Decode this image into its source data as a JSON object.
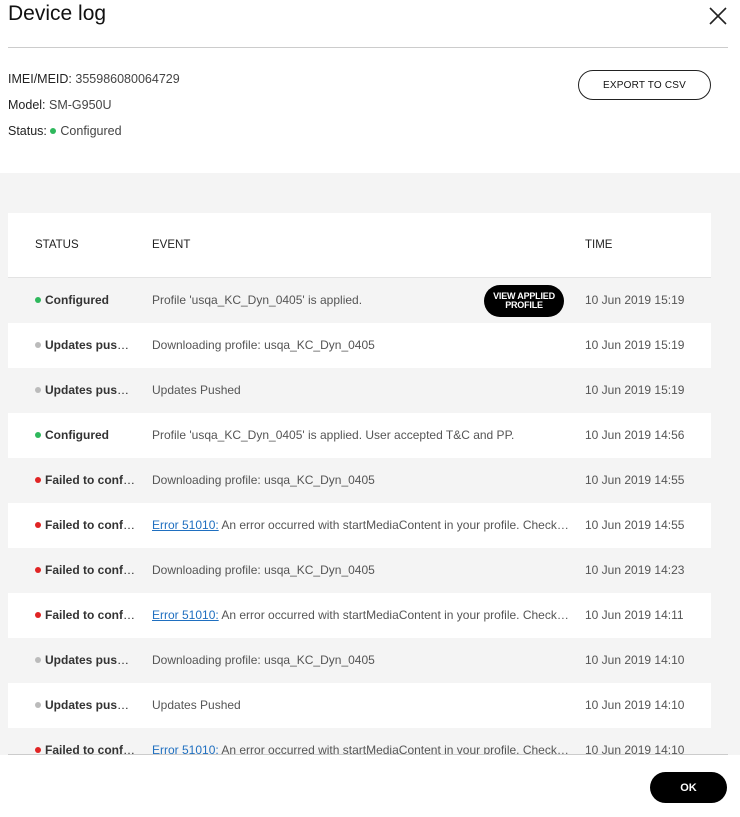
{
  "dialog": {
    "title": "Device log",
    "close_icon": "close-icon"
  },
  "device": {
    "imei_label": "IMEI/MEID:",
    "imei_value": "355986080064729",
    "model_label": "Model:",
    "model_value": "SM-G950U",
    "status_label": "Status:",
    "status_value": "Configured",
    "status_color": "#2eb85c"
  },
  "toolbar": {
    "export_label": "EXPORT TO CSV"
  },
  "colors": {
    "configured": "#2eb85c",
    "pushed": "#bbbbbb",
    "failed": "#e02424",
    "link": "#1f6fc0"
  },
  "table": {
    "headers": {
      "status": "STATUS",
      "event": "EVENT",
      "time": "TIME"
    },
    "view_button_label": "VIEW APPLIED PROFILE",
    "rows": [
      {
        "status": "Configured",
        "kind": "configured",
        "error_code": "",
        "event": "Profile 'usqa_KC_Dyn_0405' is applied.",
        "time": "10 Jun 2019 15:19",
        "has_view": true
      },
      {
        "status": "Updates pushed",
        "kind": "pushed",
        "error_code": "",
        "event": "Downloading profile: usqa_KC_Dyn_0405",
        "time": "10 Jun 2019 15:19",
        "has_view": false
      },
      {
        "status": "Updates pushed",
        "kind": "pushed",
        "error_code": "",
        "event": "Updates Pushed",
        "time": "10 Jun 2019 15:19",
        "has_view": false
      },
      {
        "status": "Configured",
        "kind": "configured",
        "error_code": "",
        "event": "Profile 'usqa_KC_Dyn_0405' is applied. User accepted T&C and PP.",
        "time": "10 Jun 2019 14:56",
        "has_view": false
      },
      {
        "status": "Failed to configure",
        "kind": "failed",
        "error_code": "",
        "event": "Downloading profile: usqa_KC_Dyn_0405",
        "time": "10 Jun 2019 14:55",
        "has_view": false
      },
      {
        "status": "Failed to configure",
        "kind": "failed",
        "error_code": "Error 51010:",
        "event": " An error occurred with startMediaContent in your profile. Check the profile",
        "time": "10 Jun 2019 14:55",
        "has_view": false
      },
      {
        "status": "Failed to configure",
        "kind": "failed",
        "error_code": "",
        "event": "Downloading profile: usqa_KC_Dyn_0405",
        "time": "10 Jun 2019 14:23",
        "has_view": false
      },
      {
        "status": "Failed to configure",
        "kind": "failed",
        "error_code": "Error 51010:",
        "event": " An error occurred with startMediaContent in your profile. Check the profile",
        "time": "10 Jun 2019 14:11",
        "has_view": false
      },
      {
        "status": "Updates pushed",
        "kind": "pushed",
        "error_code": "",
        "event": "Downloading profile: usqa_KC_Dyn_0405",
        "time": "10 Jun 2019 14:10",
        "has_view": false
      },
      {
        "status": "Updates pushed",
        "kind": "pushed",
        "error_code": "",
        "event": "Updates Pushed",
        "time": "10 Jun 2019 14:10",
        "has_view": false
      },
      {
        "status": "Failed to configure",
        "kind": "failed",
        "error_code": "Error 51010:",
        "event": " An error occurred with startMediaContent in your profile. Check the profile",
        "time": "10 Jun 2019 14:10",
        "has_view": false
      }
    ]
  },
  "footer": {
    "ok_label": "OK"
  }
}
